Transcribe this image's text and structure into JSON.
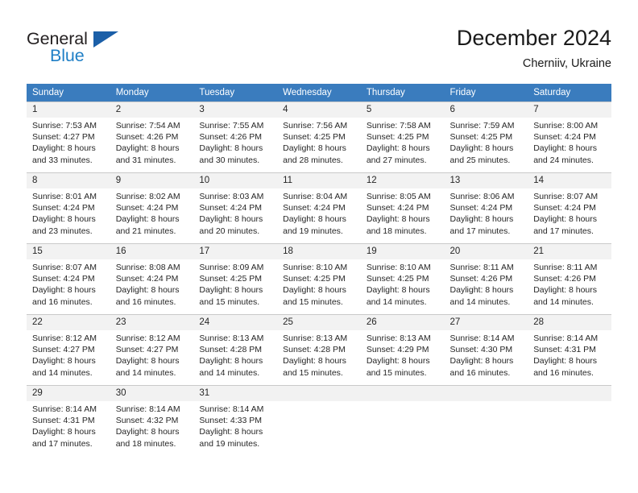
{
  "branding": {
    "logo_word_1": "General",
    "logo_word_2": "Blue",
    "logo_icon": "triangle-logo-icon",
    "color_primary": "#1b5fa8",
    "color_accent": "#1f7fc6"
  },
  "header": {
    "title": "December 2024",
    "location": "Cherniiv, Ukraine"
  },
  "calendar": {
    "header_bg": "#3a7cbe",
    "daynum_bg": "#f2f2f2",
    "weekdays": [
      "Sunday",
      "Monday",
      "Tuesday",
      "Wednesday",
      "Thursday",
      "Friday",
      "Saturday"
    ],
    "weeks": [
      [
        {
          "day": "1",
          "sunrise": "Sunrise: 7:53 AM",
          "sunset": "Sunset: 4:27 PM",
          "daylight_1": "Daylight: 8 hours",
          "daylight_2": "and 33 minutes."
        },
        {
          "day": "2",
          "sunrise": "Sunrise: 7:54 AM",
          "sunset": "Sunset: 4:26 PM",
          "daylight_1": "Daylight: 8 hours",
          "daylight_2": "and 31 minutes."
        },
        {
          "day": "3",
          "sunrise": "Sunrise: 7:55 AM",
          "sunset": "Sunset: 4:26 PM",
          "daylight_1": "Daylight: 8 hours",
          "daylight_2": "and 30 minutes."
        },
        {
          "day": "4",
          "sunrise": "Sunrise: 7:56 AM",
          "sunset": "Sunset: 4:25 PM",
          "daylight_1": "Daylight: 8 hours",
          "daylight_2": "and 28 minutes."
        },
        {
          "day": "5",
          "sunrise": "Sunrise: 7:58 AM",
          "sunset": "Sunset: 4:25 PM",
          "daylight_1": "Daylight: 8 hours",
          "daylight_2": "and 27 minutes."
        },
        {
          "day": "6",
          "sunrise": "Sunrise: 7:59 AM",
          "sunset": "Sunset: 4:25 PM",
          "daylight_1": "Daylight: 8 hours",
          "daylight_2": "and 25 minutes."
        },
        {
          "day": "7",
          "sunrise": "Sunrise: 8:00 AM",
          "sunset": "Sunset: 4:24 PM",
          "daylight_1": "Daylight: 8 hours",
          "daylight_2": "and 24 minutes."
        }
      ],
      [
        {
          "day": "8",
          "sunrise": "Sunrise: 8:01 AM",
          "sunset": "Sunset: 4:24 PM",
          "daylight_1": "Daylight: 8 hours",
          "daylight_2": "and 23 minutes."
        },
        {
          "day": "9",
          "sunrise": "Sunrise: 8:02 AM",
          "sunset": "Sunset: 4:24 PM",
          "daylight_1": "Daylight: 8 hours",
          "daylight_2": "and 21 minutes."
        },
        {
          "day": "10",
          "sunrise": "Sunrise: 8:03 AM",
          "sunset": "Sunset: 4:24 PM",
          "daylight_1": "Daylight: 8 hours",
          "daylight_2": "and 20 minutes."
        },
        {
          "day": "11",
          "sunrise": "Sunrise: 8:04 AM",
          "sunset": "Sunset: 4:24 PM",
          "daylight_1": "Daylight: 8 hours",
          "daylight_2": "and 19 minutes."
        },
        {
          "day": "12",
          "sunrise": "Sunrise: 8:05 AM",
          "sunset": "Sunset: 4:24 PM",
          "daylight_1": "Daylight: 8 hours",
          "daylight_2": "and 18 minutes."
        },
        {
          "day": "13",
          "sunrise": "Sunrise: 8:06 AM",
          "sunset": "Sunset: 4:24 PM",
          "daylight_1": "Daylight: 8 hours",
          "daylight_2": "and 17 minutes."
        },
        {
          "day": "14",
          "sunrise": "Sunrise: 8:07 AM",
          "sunset": "Sunset: 4:24 PM",
          "daylight_1": "Daylight: 8 hours",
          "daylight_2": "and 17 minutes."
        }
      ],
      [
        {
          "day": "15",
          "sunrise": "Sunrise: 8:07 AM",
          "sunset": "Sunset: 4:24 PM",
          "daylight_1": "Daylight: 8 hours",
          "daylight_2": "and 16 minutes."
        },
        {
          "day": "16",
          "sunrise": "Sunrise: 8:08 AM",
          "sunset": "Sunset: 4:24 PM",
          "daylight_1": "Daylight: 8 hours",
          "daylight_2": "and 16 minutes."
        },
        {
          "day": "17",
          "sunrise": "Sunrise: 8:09 AM",
          "sunset": "Sunset: 4:25 PM",
          "daylight_1": "Daylight: 8 hours",
          "daylight_2": "and 15 minutes."
        },
        {
          "day": "18",
          "sunrise": "Sunrise: 8:10 AM",
          "sunset": "Sunset: 4:25 PM",
          "daylight_1": "Daylight: 8 hours",
          "daylight_2": "and 15 minutes."
        },
        {
          "day": "19",
          "sunrise": "Sunrise: 8:10 AM",
          "sunset": "Sunset: 4:25 PM",
          "daylight_1": "Daylight: 8 hours",
          "daylight_2": "and 14 minutes."
        },
        {
          "day": "20",
          "sunrise": "Sunrise: 8:11 AM",
          "sunset": "Sunset: 4:26 PM",
          "daylight_1": "Daylight: 8 hours",
          "daylight_2": "and 14 minutes."
        },
        {
          "day": "21",
          "sunrise": "Sunrise: 8:11 AM",
          "sunset": "Sunset: 4:26 PM",
          "daylight_1": "Daylight: 8 hours",
          "daylight_2": "and 14 minutes."
        }
      ],
      [
        {
          "day": "22",
          "sunrise": "Sunrise: 8:12 AM",
          "sunset": "Sunset: 4:27 PM",
          "daylight_1": "Daylight: 8 hours",
          "daylight_2": "and 14 minutes."
        },
        {
          "day": "23",
          "sunrise": "Sunrise: 8:12 AM",
          "sunset": "Sunset: 4:27 PM",
          "daylight_1": "Daylight: 8 hours",
          "daylight_2": "and 14 minutes."
        },
        {
          "day": "24",
          "sunrise": "Sunrise: 8:13 AM",
          "sunset": "Sunset: 4:28 PM",
          "daylight_1": "Daylight: 8 hours",
          "daylight_2": "and 14 minutes."
        },
        {
          "day": "25",
          "sunrise": "Sunrise: 8:13 AM",
          "sunset": "Sunset: 4:28 PM",
          "daylight_1": "Daylight: 8 hours",
          "daylight_2": "and 15 minutes."
        },
        {
          "day": "26",
          "sunrise": "Sunrise: 8:13 AM",
          "sunset": "Sunset: 4:29 PM",
          "daylight_1": "Daylight: 8 hours",
          "daylight_2": "and 15 minutes."
        },
        {
          "day": "27",
          "sunrise": "Sunrise: 8:14 AM",
          "sunset": "Sunset: 4:30 PM",
          "daylight_1": "Daylight: 8 hours",
          "daylight_2": "and 16 minutes."
        },
        {
          "day": "28",
          "sunrise": "Sunrise: 8:14 AM",
          "sunset": "Sunset: 4:31 PM",
          "daylight_1": "Daylight: 8 hours",
          "daylight_2": "and 16 minutes."
        }
      ],
      [
        {
          "day": "29",
          "sunrise": "Sunrise: 8:14 AM",
          "sunset": "Sunset: 4:31 PM",
          "daylight_1": "Daylight: 8 hours",
          "daylight_2": "and 17 minutes."
        },
        {
          "day": "30",
          "sunrise": "Sunrise: 8:14 AM",
          "sunset": "Sunset: 4:32 PM",
          "daylight_1": "Daylight: 8 hours",
          "daylight_2": "and 18 minutes."
        },
        {
          "day": "31",
          "sunrise": "Sunrise: 8:14 AM",
          "sunset": "Sunset: 4:33 PM",
          "daylight_1": "Daylight: 8 hours",
          "daylight_2": "and 19 minutes."
        },
        {
          "day": "",
          "sunrise": "",
          "sunset": "",
          "daylight_1": "",
          "daylight_2": ""
        },
        {
          "day": "",
          "sunrise": "",
          "sunset": "",
          "daylight_1": "",
          "daylight_2": ""
        },
        {
          "day": "",
          "sunrise": "",
          "sunset": "",
          "daylight_1": "",
          "daylight_2": ""
        },
        {
          "day": "",
          "sunrise": "",
          "sunset": "",
          "daylight_1": "",
          "daylight_2": ""
        }
      ]
    ]
  }
}
